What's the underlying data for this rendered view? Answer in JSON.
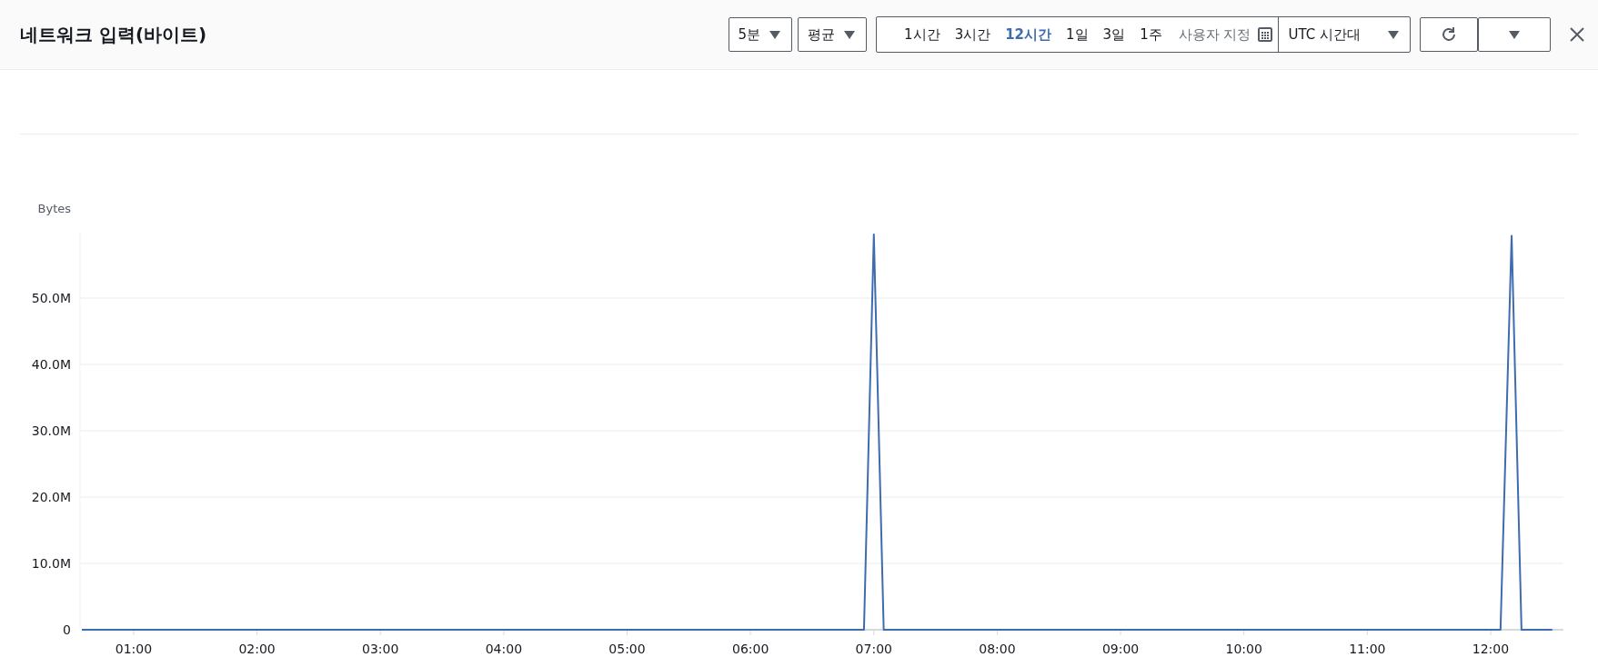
{
  "title": "네트워크 입력(바이트)",
  "period": {
    "value": "5분"
  },
  "statistic": {
    "value": "평균"
  },
  "time_ranges": [
    {
      "label": "1시간",
      "selected": false
    },
    {
      "label": "3시간",
      "selected": false
    },
    {
      "label": "12시간",
      "selected": true
    },
    {
      "label": "1일",
      "selected": false
    },
    {
      "label": "3일",
      "selected": false
    },
    {
      "label": "1주",
      "selected": false
    }
  ],
  "custom_range": {
    "label": "사용자 지정"
  },
  "timezone": {
    "value": "UTC 시간대"
  },
  "chart_data": {
    "type": "line",
    "ylabel": "Bytes",
    "x": [
      0.58,
      6.92,
      7.0,
      7.08,
      12.08,
      12.17,
      12.25,
      12.5
    ],
    "series": [
      {
        "color": "#3f6bb0",
        "values": [
          0,
          0,
          59600000,
          0,
          0,
          59400000,
          0,
          0
        ]
      }
    ],
    "xlim": [
      0.58,
      12.59
    ],
    "ylim": [
      0,
      60000000
    ],
    "grid": true,
    "xticks": [
      {
        "value": 1,
        "label": "01:00"
      },
      {
        "value": 2,
        "label": "02:00"
      },
      {
        "value": 3,
        "label": "03:00"
      },
      {
        "value": 4,
        "label": "04:00"
      },
      {
        "value": 5,
        "label": "05:00"
      },
      {
        "value": 6,
        "label": "06:00"
      },
      {
        "value": 7,
        "label": "07:00"
      },
      {
        "value": 8,
        "label": "08:00"
      },
      {
        "value": 9,
        "label": "09:00"
      },
      {
        "value": 10,
        "label": "10:00"
      },
      {
        "value": 11,
        "label": "11:00"
      },
      {
        "value": 12,
        "label": "12:00"
      }
    ],
    "yticks": [
      {
        "value": 0,
        "label": "0"
      },
      {
        "value": 10000000,
        "label": "10.0M"
      },
      {
        "value": 20000000,
        "label": "20.0M"
      },
      {
        "value": 30000000,
        "label": "30.0M"
      },
      {
        "value": 40000000,
        "label": "40.0M"
      },
      {
        "value": 50000000,
        "label": "50.0M"
      }
    ]
  }
}
